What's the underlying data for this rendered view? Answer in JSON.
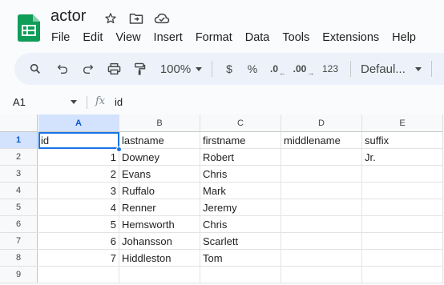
{
  "document": {
    "title": "actor"
  },
  "title_icons": [
    "star-icon",
    "move-to-folder-icon",
    "cloud-status-icon"
  ],
  "menu": [
    "File",
    "Edit",
    "View",
    "Insert",
    "Format",
    "Data",
    "Tools",
    "Extensions",
    "Help"
  ],
  "toolbar": {
    "zoom": "100%",
    "currency": "$",
    "percent": "%",
    "decrease_decimal": ".0",
    "increase_decimal": ".00",
    "number_format": "123",
    "font": "Defaul..."
  },
  "formula_bar": {
    "cell_ref": "A1",
    "fx": "fx",
    "content": "id"
  },
  "grid": {
    "columns": [
      "A",
      "B",
      "C",
      "D",
      "E"
    ],
    "selected_column": "A",
    "selected_row": "1",
    "rows": [
      {
        "n": "1",
        "cells": [
          "id",
          "lastname",
          "firstname",
          "middlename",
          "suffix"
        ]
      },
      {
        "n": "2",
        "cells": [
          "1",
          "Downey",
          "Robert",
          "",
          "Jr."
        ]
      },
      {
        "n": "3",
        "cells": [
          "2",
          "Evans",
          "Chris",
          "",
          ""
        ]
      },
      {
        "n": "4",
        "cells": [
          "3",
          "Ruffalo",
          "Mark",
          "",
          ""
        ]
      },
      {
        "n": "5",
        "cells": [
          "4",
          "Renner",
          "Jeremy",
          "",
          ""
        ]
      },
      {
        "n": "6",
        "cells": [
          "5",
          "Hemsworth",
          "Chris",
          "",
          ""
        ]
      },
      {
        "n": "7",
        "cells": [
          "6",
          "Johansson",
          "Scarlett",
          "",
          ""
        ]
      },
      {
        "n": "8",
        "cells": [
          "7",
          "Hiddleston",
          "Tom",
          "",
          ""
        ]
      },
      {
        "n": "9",
        "cells": [
          "",
          "",
          "",
          "",
          ""
        ]
      }
    ]
  },
  "colors": {
    "accent": "#1a73e8",
    "selected_header": "#d3e3fd",
    "toolbar_bg": "#edf2fa",
    "logo_green": "#0f9d58"
  }
}
